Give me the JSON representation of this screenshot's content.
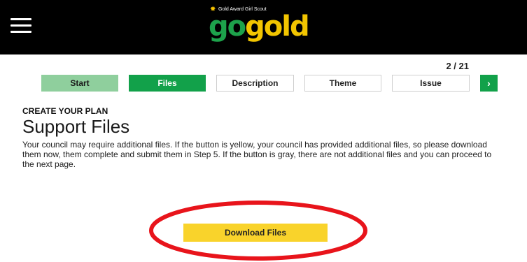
{
  "header": {
    "menu_icon": "hamburger-menu-icon",
    "logo": {
      "tagline": "Gold Award Girl Scout",
      "word_go": "go",
      "word_gold": "gold",
      "colors": {
        "go": "#1da24b",
        "gold": "#f2c500",
        "bar": "#000000"
      }
    }
  },
  "progress": {
    "counter": "2 / 21"
  },
  "steps": [
    {
      "label": "Start",
      "state": "done"
    },
    {
      "label": "Files",
      "state": "active"
    },
    {
      "label": "Description",
      "state": "upcoming"
    },
    {
      "label": "Theme",
      "state": "upcoming"
    },
    {
      "label": "Issue",
      "state": "upcoming"
    }
  ],
  "next_icon": "chevron-right-icon",
  "next_label": "›",
  "content": {
    "kicker": "CREATE YOUR PLAN",
    "title": "Support Files",
    "description": "Your council may require additional files. If the button is yellow, your council has provided additional files, so please download them now, them complete and submit them in Step 5.  If the button is gray, there are not additional files and you can proceed to the next page.",
    "download_label": "Download Files"
  },
  "colors": {
    "step_done": "#8fcf9d",
    "step_active": "#12a14a",
    "download_button": "#f9d32b",
    "annotation_ring": "#e8141b"
  }
}
